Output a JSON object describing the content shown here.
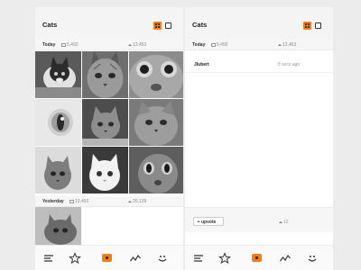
{
  "left": {
    "title": "Cats",
    "today": {
      "label": "Today",
      "images": "5,492",
      "upvotes": "12,453"
    },
    "yesterday": {
      "label": "Yesterday",
      "images": "10,452",
      "upvotes": "20,129"
    }
  },
  "right": {
    "title": "Cats",
    "today": {
      "label": "Today",
      "images": "5,492",
      "upvotes": "12,453"
    },
    "row": {
      "user": "Jlubert",
      "time": "8 secs ago"
    },
    "upvote": {
      "label": "upvote",
      "count": "12"
    }
  },
  "icons": {
    "grid_view": "grid-view-icon",
    "single_view": "single-view-icon",
    "list": "list-icon",
    "star": "star-icon",
    "camera": "camera-icon",
    "trending": "trending-icon",
    "smile": "smile-icon"
  },
  "colors": {
    "accent": "#f07f1b",
    "background": "#ececec"
  }
}
